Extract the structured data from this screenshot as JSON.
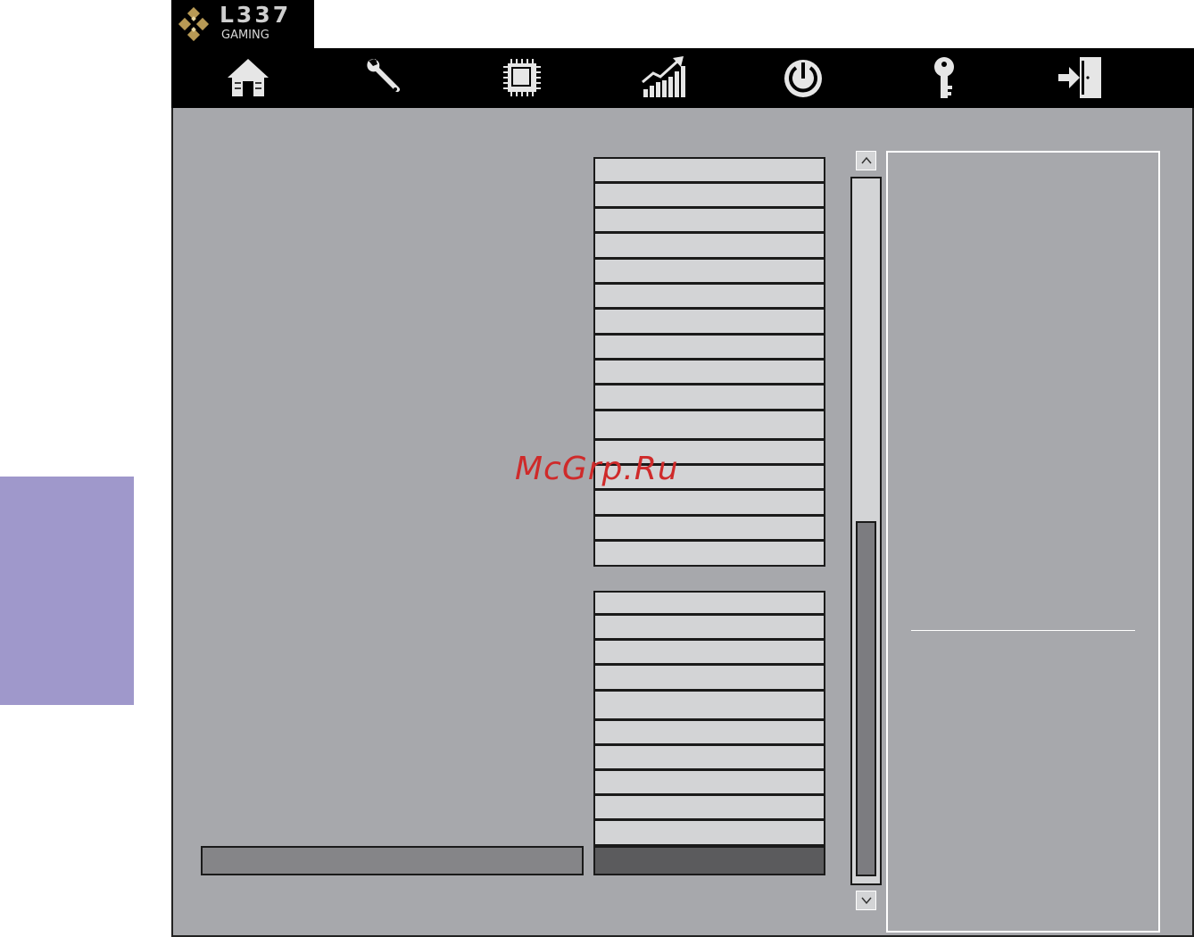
{
  "brand": {
    "title": "L337",
    "subtitle": "GAMING"
  },
  "nav": [
    {
      "name": "home",
      "icon": "home-icon"
    },
    {
      "name": "settings",
      "icon": "wrench-icon"
    },
    {
      "name": "memory",
      "icon": "chip-icon"
    },
    {
      "name": "performance",
      "icon": "chart-icon"
    },
    {
      "name": "power",
      "icon": "power-icon"
    },
    {
      "name": "key",
      "icon": "key-icon"
    },
    {
      "name": "exit",
      "icon": "exit-icon"
    }
  ],
  "list_a": {
    "row_count": 16
  },
  "list_b": {
    "row_count": 10
  },
  "scrollbar": {
    "position_fraction": 0.5
  },
  "watermark": "McGrp.Ru",
  "colors": {
    "nav_bg": "#000000",
    "panel_bg": "#a7a8ac",
    "row_bg": "#d3d4d6",
    "side_tab": "#9f98cb",
    "icon_fill": "#e6e6e6",
    "watermark": "#cf2a2a"
  }
}
